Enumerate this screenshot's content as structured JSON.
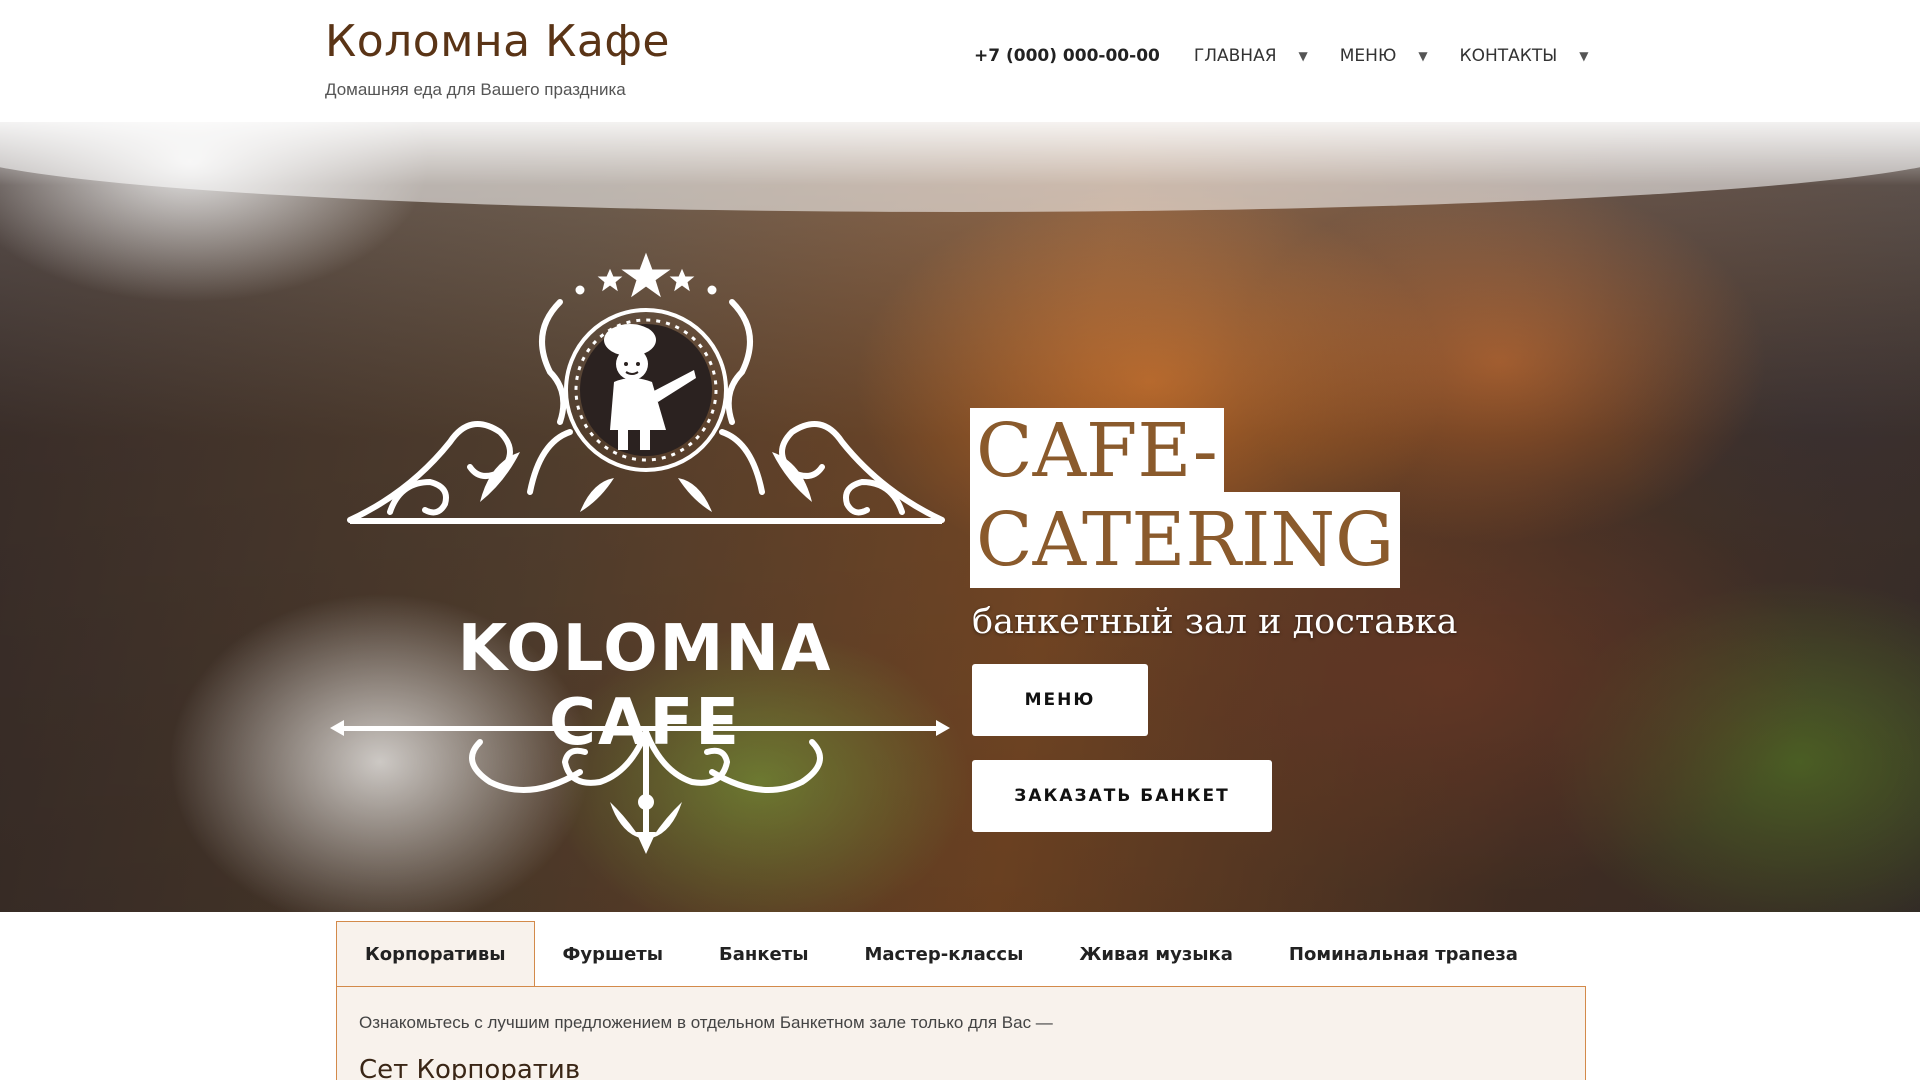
{
  "header": {
    "title": "Коломна Кафе",
    "tagline": "Домашняя еда для Вашего праздника",
    "phone": "+7 (000) 000-00-00",
    "nav": [
      {
        "label": "ГЛАВНАЯ"
      },
      {
        "label": "МЕНЮ"
      },
      {
        "label": "КОНТАКТЫ"
      }
    ],
    "caret": "▼"
  },
  "hero": {
    "logo_text": "KOLOMNA CAFE",
    "tagline_line1": "CAFE-",
    "tagline_line2": "CATERING",
    "subtitle": "банкетный зал и доставка",
    "buttons": {
      "menu": "МЕНЮ",
      "order_banquet": "ЗАКАЗАТЬ БАНКЕТ"
    }
  },
  "tabs": {
    "items": [
      {
        "label": "Корпоративы",
        "active": true
      },
      {
        "label": "Фуршеты"
      },
      {
        "label": "Банкеты"
      },
      {
        "label": "Мастер-классы"
      },
      {
        "label": "Живая музыка"
      },
      {
        "label": "Поминальная трапеза"
      }
    ],
    "panel": {
      "text": "Ознакомьтесь с лучшим предложением в отдельном Банкетном зале только для Вас —",
      "heading": "Сет Корпоратив"
    }
  },
  "colors": {
    "brand_brown": "#5a3416",
    "tab_border": "#d38a4a",
    "tab_bg": "#f8f2ec",
    "tagline_text": "#8a5a2c"
  }
}
